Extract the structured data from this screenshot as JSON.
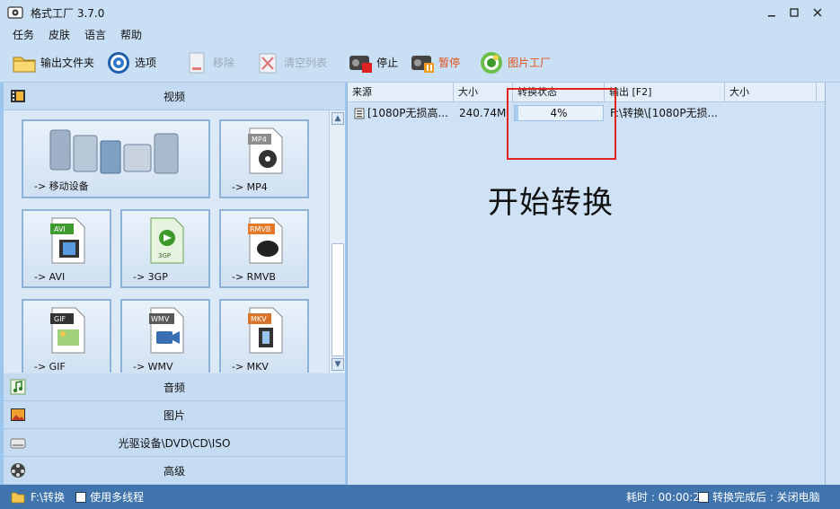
{
  "window": {
    "title": "格式工厂 3.7.0"
  },
  "menu": [
    "任务",
    "皮肤",
    "语言",
    "帮助"
  ],
  "toolbar": {
    "output_folder": "输出文件夹",
    "options": "选项",
    "remove": "移除",
    "clear_list": "清空列表",
    "stop": "停止",
    "pause": "暂停",
    "picture_factory": "图片工厂"
  },
  "categories": {
    "video": "视频",
    "audio": "音频",
    "picture": "图片",
    "disc": "光驱设备\\DVD\\CD\\ISO",
    "advanced": "高级"
  },
  "tiles": [
    {
      "label": "-> 移动设备",
      "badge": ""
    },
    {
      "label": "-> MP4",
      "badge": "MP4"
    },
    {
      "label": "-> AVI",
      "badge": "AVI"
    },
    {
      "label": "-> 3GP",
      "badge": "3GP"
    },
    {
      "label": "-> RMVB",
      "badge": "RMVB"
    },
    {
      "label": "-> GIF",
      "badge": "GIF"
    },
    {
      "label": "-> WMV",
      "badge": "WMV"
    },
    {
      "label": "-> MKV",
      "badge": "MKV"
    }
  ],
  "list": {
    "columns": [
      "来源",
      "大小",
      "转换状态",
      "输出 [F2]",
      "大小"
    ],
    "rows": [
      {
        "source": "[1080P无损高...",
        "size": "240.74M",
        "progress": 4,
        "progress_text": "4%",
        "output": "F:\\转换\\[1080P无损..."
      }
    ]
  },
  "annotation": "开始转换",
  "status": {
    "output_path": "F:\\转换",
    "multithread": "使用多线程",
    "elapsed": "耗时 : 00:00:25",
    "after_done": "转换完成后 : 关闭电脑"
  },
  "colors": {
    "status_bar": "#3f74ac",
    "highlight": "#e42222",
    "accent": "#e0501a"
  }
}
